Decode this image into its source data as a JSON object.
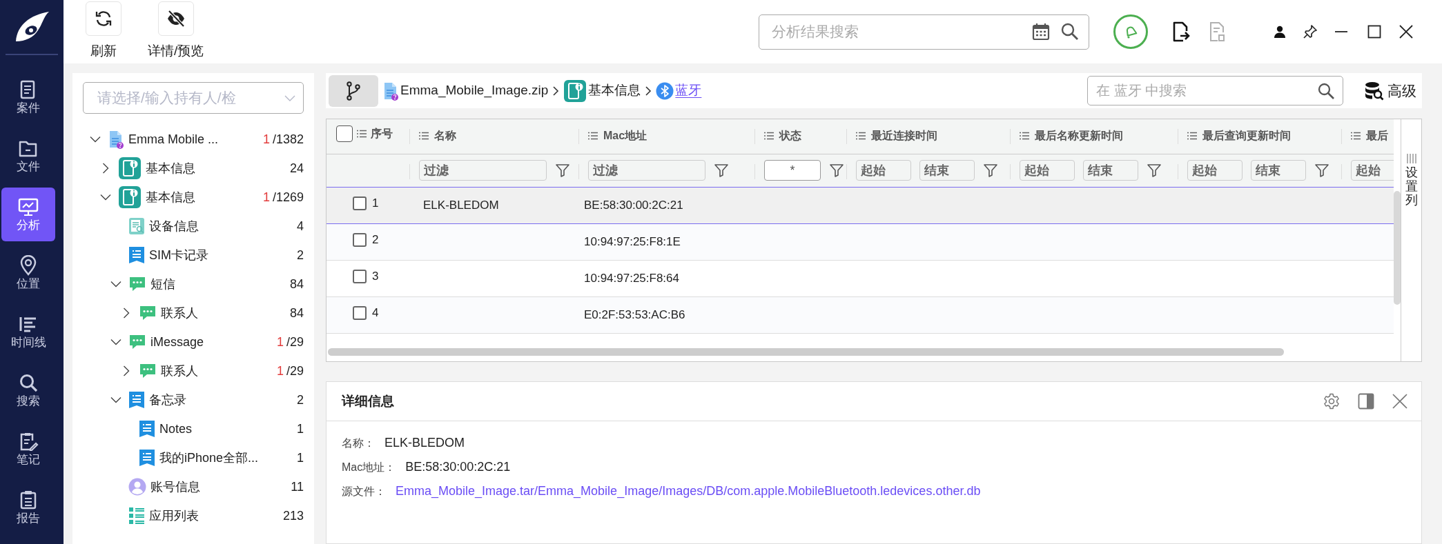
{
  "nav": [
    {
      "label": "案件",
      "kind": "case",
      "selected": false
    },
    {
      "label": "文件",
      "kind": "file",
      "selected": false
    },
    {
      "label": "分析",
      "kind": "analysis",
      "selected": true
    },
    {
      "label": "位置",
      "kind": "location",
      "selected": false
    },
    {
      "label": "时间线",
      "kind": "timeline",
      "selected": false
    },
    {
      "label": "搜索",
      "kind": "search",
      "selected": false
    },
    {
      "label": "笔记",
      "kind": "notes",
      "selected": false
    },
    {
      "label": "报告",
      "kind": "report",
      "selected": false
    }
  ],
  "toolbar": [
    {
      "label": "刷新",
      "kind": "refresh"
    },
    {
      "label": "详情/预览",
      "kind": "preview"
    }
  ],
  "search": {
    "placeholder": "分析结果搜索"
  },
  "owner_select": {
    "placeholder": "请选择/输入持有人/检"
  },
  "tree": [
    {
      "label": "Emma  Mobile  ...",
      "kind": "file",
      "new": "1",
      "count": "/1382",
      "expanded": true,
      "children": [
        {
          "label": "基本信息",
          "kind": "device",
          "count": "24",
          "expanded": false
        },
        {
          "label": "基本信息",
          "kind": "device",
          "new": "1",
          "count": "/1269",
          "expanded": true,
          "children": [
            {
              "label": "设备信息",
              "kind": "device-info",
              "count": "4"
            },
            {
              "label": "SIM卡记录",
              "kind": "note",
              "count": "2"
            },
            {
              "label": "短信",
              "kind": "chat",
              "count": "84",
              "expanded": true,
              "children": [
                {
                  "label": "联系人",
                  "kind": "chat",
                  "count": "84",
                  "expanded": false
                }
              ]
            },
            {
              "label": "iMessage",
              "kind": "chat",
              "new": "1",
              "count": "/29",
              "expanded": true,
              "children": [
                {
                  "label": "联系人",
                  "kind": "chat",
                  "new": "1",
                  "count": "/29",
                  "expanded": false
                }
              ]
            },
            {
              "label": "备忘录",
              "kind": "note",
              "count": "2",
              "expanded": true,
              "children": [
                {
                  "label": "Notes",
                  "kind": "note",
                  "count": "1"
                },
                {
                  "label": "我的iPhone全部...",
                  "kind": "note",
                  "count": "1"
                }
              ]
            },
            {
              "label": "账号信息",
              "kind": "account",
              "count": "11"
            },
            {
              "label": "应用列表",
              "kind": "apps",
              "count": "213"
            }
          ]
        }
      ]
    }
  ],
  "breadcrumb": [
    {
      "label": "Emma_Mobile_Image.zip",
      "kind": "file",
      "selected": false
    },
    {
      "label": "基本信息",
      "kind": "device",
      "selected": false
    },
    {
      "label": "蓝牙",
      "kind": "bluetooth",
      "selected": true
    }
  ],
  "table_search": {
    "placeholder": "在 蓝牙 中搜索"
  },
  "advanced": {
    "label": "高级"
  },
  "table": {
    "all_checked": false,
    "columns": [
      {
        "label": "序号"
      },
      {
        "label": "名称",
        "filters": [
          {
            "placeholder": "过滤"
          }
        ]
      },
      {
        "label": "Mac地址",
        "filters": [
          {
            "placeholder": "过滤"
          }
        ]
      },
      {
        "label": "状态",
        "filters": [
          {
            "value": "*"
          }
        ]
      },
      {
        "label": "最近连接时间",
        "filters": [
          {
            "placeholder": "起始"
          },
          {
            "placeholder": "结束"
          }
        ]
      },
      {
        "label": "最后名称更新时间",
        "filters": [
          {
            "placeholder": "起始"
          },
          {
            "placeholder": "结束"
          }
        ]
      },
      {
        "label": "最后查询更新时间",
        "filters": [
          {
            "placeholder": "起始"
          },
          {
            "placeholder": "结束"
          }
        ]
      },
      {
        "label": "最后",
        "filters": [
          {
            "placeholder": "起始"
          }
        ]
      }
    ],
    "rows": [
      {
        "seq": "1",
        "name": "ELK-BLEDOM",
        "mac": "BE:58:30:00:2C:21",
        "checked": false,
        "selected": true
      },
      {
        "seq": "2",
        "mac": "10:94:97:25:F8:1E",
        "checked": false,
        "selected": false
      },
      {
        "seq": "3",
        "mac": "10:94:97:25:F8:64",
        "checked": false,
        "selected": false
      },
      {
        "seq": "4",
        "mac": "E0:2F:53:53:AC:B6",
        "checked": false,
        "selected": false
      }
    ],
    "column_settings": "设置列"
  },
  "details": {
    "title": "详细信息",
    "fields": [
      {
        "label": "名称：",
        "value": "ELK-BLEDOM",
        "kind": "text"
      },
      {
        "label": "Mac地址：",
        "value": "BE:58:30:00:2C:21",
        "kind": "text"
      },
      {
        "label": "源文件：",
        "value": "Emma_Mobile_Image.tar/Emma_Mobile_Image/Images/DB/com.apple.MobileBluetooth.ledevices.other.db",
        "kind": "link"
      }
    ]
  }
}
